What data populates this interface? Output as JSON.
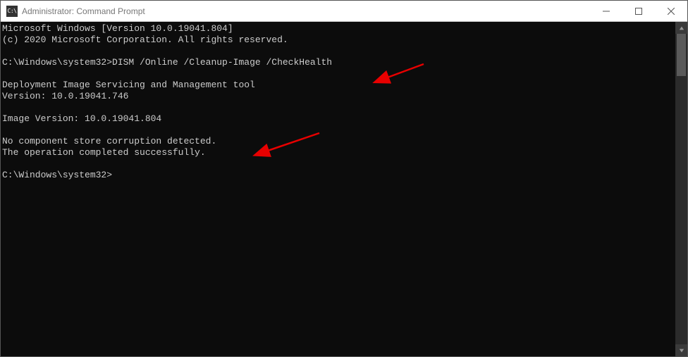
{
  "window": {
    "icon_text": "C:\\",
    "title": "Administrator: Command Prompt"
  },
  "terminal": {
    "line1": "Microsoft Windows [Version 10.0.19041.804]",
    "line2": "(c) 2020 Microsoft Corporation. All rights reserved.",
    "blank1": "",
    "prompt1_prefix": "C:\\Windows\\system32>",
    "prompt1_command": "DISM /Online /Cleanup-Image /CheckHealth",
    "blank2": "",
    "tool1": "Deployment Image Servicing and Management tool",
    "tool2": "Version: 10.0.19041.746",
    "blank3": "",
    "imgver": "Image Version: 10.0.19041.804",
    "blank4": "",
    "result1": "No component store corruption detected.",
    "result2": "The operation completed successfully.",
    "blank5": "",
    "prompt2": "C:\\Windows\\system32>"
  }
}
